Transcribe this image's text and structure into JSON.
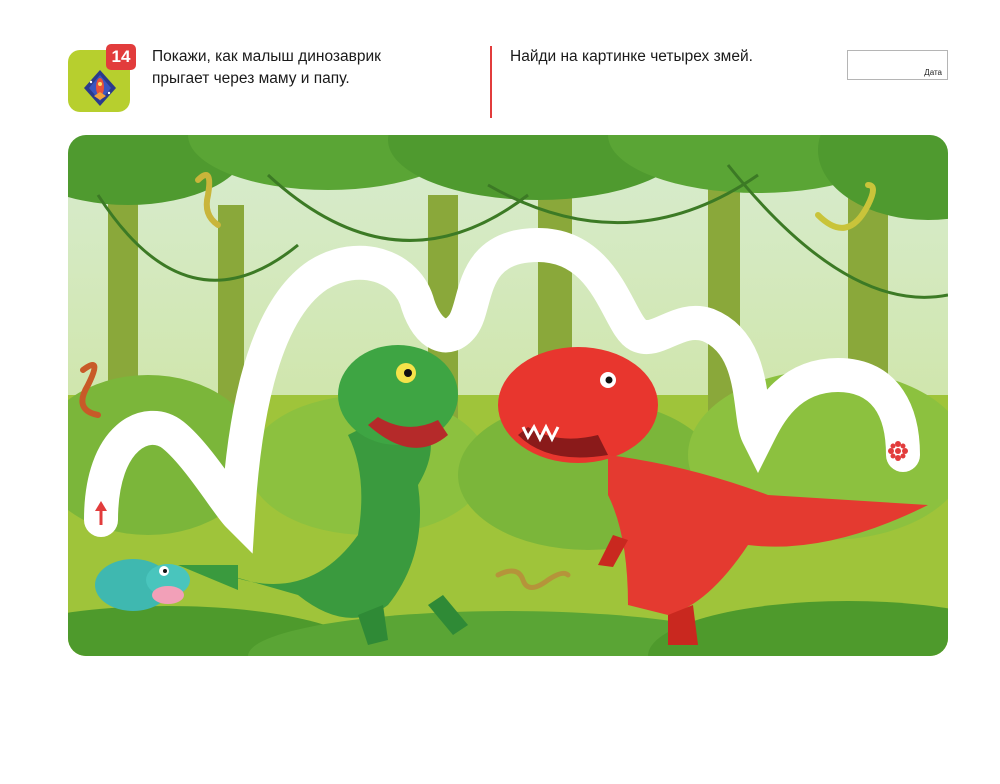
{
  "badge": {
    "number": "14",
    "icon": "rocket-icon"
  },
  "task_left": {
    "line1": "Покажи, как малыш динозаврик",
    "line2": "прыгает через маму и папу."
  },
  "task_right": {
    "text": "Найди на картинке четырех змей."
  },
  "date": {
    "label": "Дата"
  },
  "colors": {
    "accent_red": "#e23c3c",
    "badge_green": "#b7cf2e",
    "jungle_green": "#5a9a2a",
    "path_white": "#ffffff"
  }
}
